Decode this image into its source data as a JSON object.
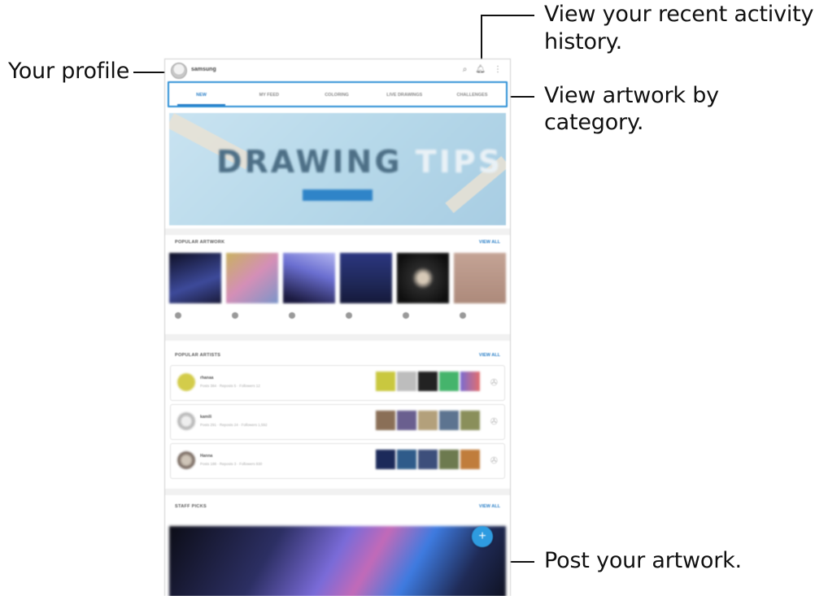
{
  "callouts": {
    "profile": "Your profile",
    "activity_line1": "View your recent activity",
    "activity_line2": "history.",
    "category": "View artwork by category.",
    "post": "Post your artwork."
  },
  "app": {
    "username": "samsung",
    "top_icons": [
      "search-icon",
      "bell-icon",
      "more-icon"
    ],
    "tabs": [
      "NEW",
      "MY FEED",
      "COLORING",
      "LIVE DRAWINGS",
      "CHALLENGES"
    ],
    "active_tab": "NEW",
    "accent_color": "#2a7fc7",
    "banner": {
      "title_main": "DRAWING",
      "title_accent": "TIPS"
    },
    "popular_artwork": {
      "title": "POPULAR ARTWORK",
      "view_all": "VIEW ALL"
    },
    "popular_artists": {
      "title": "POPULAR ARTISTS",
      "view_all": "VIEW ALL",
      "artists": [
        {
          "name": "rhanaa",
          "stats": "Posts 384 · Reposts 5 · Followers 12"
        },
        {
          "name": "kamili",
          "stats": "Posts 291 · Reposts 24 · Followers 1,592"
        },
        {
          "name": "Hanna",
          "stats": "Posts 188 · Reposts 3 · Followers 830"
        }
      ]
    },
    "staff_picks": {
      "title": "STAFF PICKS",
      "view_all": "VIEW ALL"
    },
    "fab_icon": "plus-icon"
  }
}
